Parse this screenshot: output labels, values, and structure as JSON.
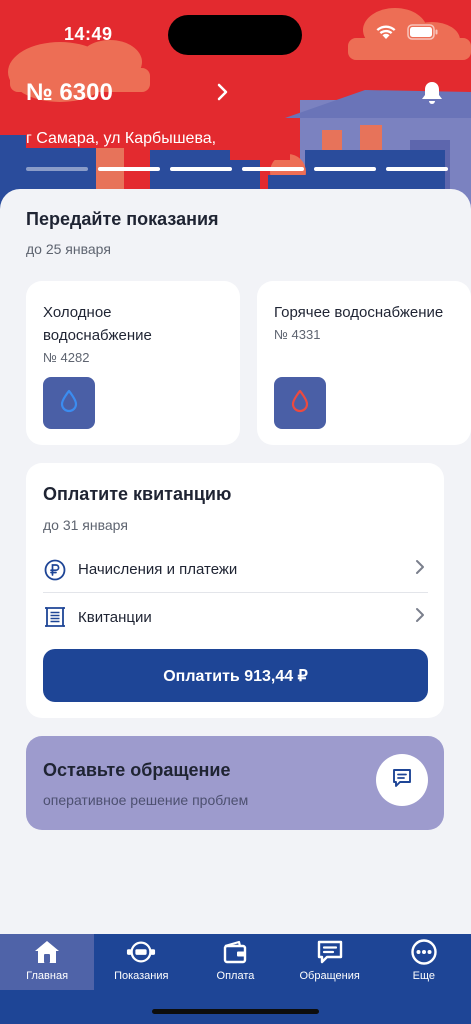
{
  "status_bar": {
    "time": "14:49"
  },
  "header": {
    "account_number": "№ 6300",
    "address": "г Самара, ул Карбышева,",
    "pager_count": 6,
    "pager_active": 0
  },
  "readings": {
    "title": "Передайте показания",
    "due": "до 25 января",
    "meters": [
      {
        "title": "Холодное водоснабжение",
        "number": "№ 4282",
        "icon": "water-drop-icon",
        "color": "#2f7fe0"
      },
      {
        "title": "Горячее водоснабжение",
        "number": "№ 4331",
        "icon": "water-drop-icon",
        "color": "#e3413a"
      }
    ]
  },
  "payment": {
    "title": "Оплатите квитанцию",
    "due": "до 31 января",
    "rows": [
      {
        "label": "Начисления и платежи",
        "icon": "ruble-circle-icon"
      },
      {
        "label": "Квитанции",
        "icon": "receipt-icon"
      }
    ],
    "pay_button": "Оплатить 913,44 ₽"
  },
  "appeal": {
    "title": "Оставьте обращение",
    "subtitle": "оперативное решение проблем"
  },
  "tabbar": {
    "items": [
      {
        "label": "Главная",
        "icon": "home-icon",
        "active": true
      },
      {
        "label": "Показания",
        "icon": "meter-icon",
        "active": false
      },
      {
        "label": "Оплата",
        "icon": "wallet-icon",
        "active": false
      },
      {
        "label": "Обращения",
        "icon": "chat-icon",
        "active": false
      },
      {
        "label": "Еще",
        "icon": "more-icon",
        "active": false
      }
    ]
  },
  "colors": {
    "hero_red": "#e32a2f",
    "brand_blue": "#1e4596",
    "appeal_lilac": "#9d9bcd"
  }
}
